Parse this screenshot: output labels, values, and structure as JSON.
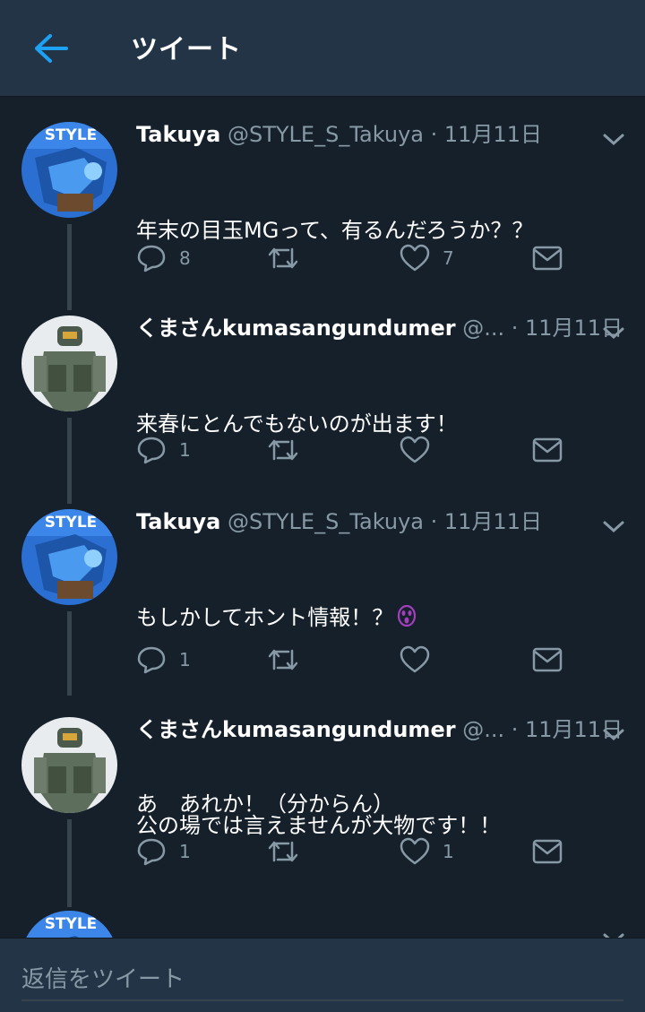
{
  "header": {
    "title": "ツイート"
  },
  "tweets": [
    {
      "name": "Takuya",
      "handle": "@STYLE_S_Takuya",
      "date": "· 11月11日",
      "lines": [
        "年末の目玉MGって、有るんだろうか？？"
      ],
      "reply_count": "8",
      "retweet_count": "",
      "like_count": "7",
      "avatar": "takuya"
    },
    {
      "name": "くまさんkumasangundumer",
      "handle": "@...",
      "date": "· 11月11日",
      "lines": [
        "来春にとんでもないのが出ます！"
      ],
      "reply_count": "1",
      "retweet_count": "",
      "like_count": "",
      "avatar": "kuma"
    },
    {
      "name": "Takuya",
      "handle": "@STYLE_S_Takuya",
      "date": "· 11月11日",
      "lines": [
        "もしかしてホント情報！？",
        "",
        "あ　あれか！（分からん）"
      ],
      "emoji": "scream-emoji",
      "reply_count": "1",
      "retweet_count": "",
      "like_count": "",
      "avatar": "takuya"
    },
    {
      "name": "くまさんkumasangundumer",
      "handle": "@...",
      "date": "· 11月11日",
      "lines": [
        "公の場では言えませんが大物です！！"
      ],
      "reply_count": "1",
      "retweet_count": "",
      "like_count": "1",
      "avatar": "kuma"
    }
  ],
  "composer": {
    "placeholder": "返信をツイート"
  },
  "colors": {
    "background": "#15202b",
    "bar": "#243447",
    "accent": "#1da1f2",
    "muted": "#8899a6"
  }
}
